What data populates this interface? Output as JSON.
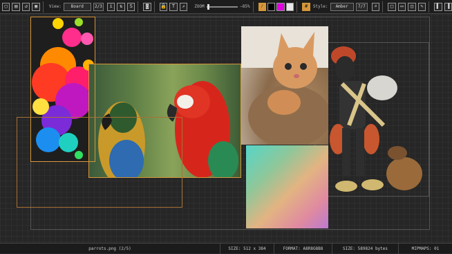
{
  "toolbar": {
    "view_label": "View:",
    "view_value": "Board",
    "view_page": "2/3",
    "zoom_label": "ZOOM",
    "zoom_value": "−85%",
    "zoom_fraction": 0.02,
    "style_label": "Style:",
    "style_value": "Amber",
    "style_page": "7/7",
    "swatches": [
      "#000000",
      "#e000e0",
      "#e8e8e8"
    ]
  },
  "accent": "#d6963a",
  "status": {
    "filename": "parrots.png (2/5)",
    "size": "SIZE:  512 x 384",
    "format": "FORMAT: A8R8G8B8",
    "bytes": "SIZE: 589824 bytes",
    "mipmaps": "MIPMAPS: 01"
  }
}
